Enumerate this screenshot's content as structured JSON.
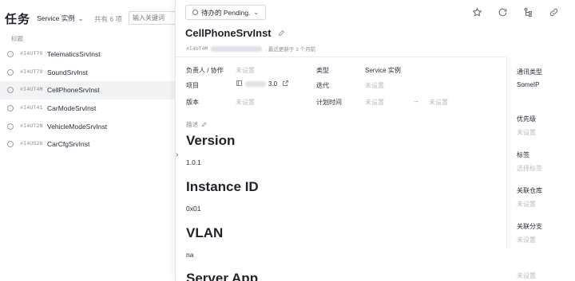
{
  "list": {
    "title": "任务",
    "type_filter": "Service 实例",
    "count_text": "共有 6 项",
    "search_placeholder": "输入关键词",
    "column_header": "标题",
    "items": [
      {
        "id": "#I4UT70",
        "name": "TelematicsSrvInst"
      },
      {
        "id": "#I4UT79",
        "name": "SoundSrvInst"
      },
      {
        "id": "#I4UT4M",
        "name": "CellPhoneSrvInst"
      },
      {
        "id": "#I4UT41",
        "name": "CarModeSrvInst"
      },
      {
        "id": "#I4UT2N",
        "name": "VehicleModeSrvInst"
      },
      {
        "id": "#I4US26",
        "name": "CarCfgSrvInst"
      }
    ]
  },
  "detail": {
    "status": "待办的 Pending.",
    "title": "CellPhoneSrvInst",
    "meta_id": "#I4UT4M",
    "meta_updated": ", 最近更新于 3 个月前",
    "fields": {
      "assignee_label": "负责人 / 协作",
      "assignee_value": "未设置",
      "type_label": "类型",
      "type_value": "Service 实例",
      "project_label": "项目",
      "project_value": "3.0",
      "iteration_label": "迭代",
      "iteration_value": "未设置",
      "version_label": "版本",
      "version_value": "未设置",
      "plan_label": "计划时间",
      "plan_start": "未设置",
      "plan_arrow": "→",
      "plan_end": "未设置"
    },
    "description_label": "描述",
    "body": {
      "h_version": "Version",
      "v_version": "1.0.1",
      "h_instance": "Instance ID",
      "v_instance": "0x01",
      "h_vlan": "VLAN",
      "v_vlan": "na",
      "h_server": "Server App"
    },
    "side": {
      "comm_label": "通讯类型",
      "comm_value": "SomeIP",
      "priority_label": "优先级",
      "priority_value": "未设置",
      "tags_label": "标签",
      "tags_value": "选择标签",
      "repo_label": "关联仓库",
      "repo_value": "未设置",
      "branch_label": "关联分支",
      "branch_value": "未设置",
      "extra_value": "未设置"
    }
  }
}
